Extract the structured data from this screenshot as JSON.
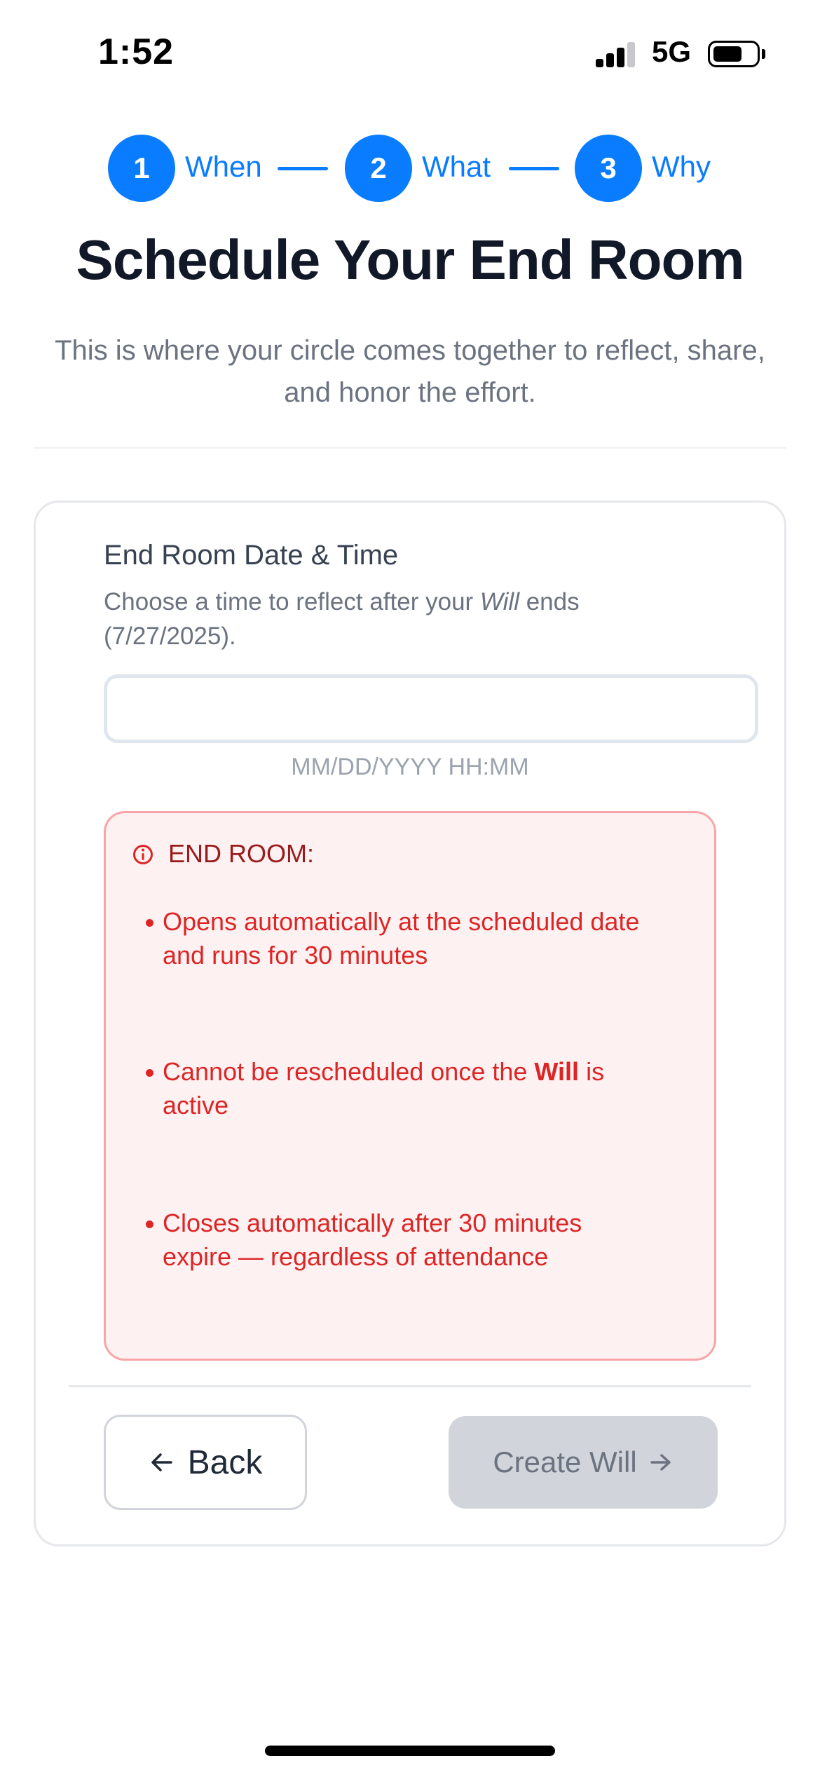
{
  "status_bar": {
    "time": "1:52",
    "network": "5G",
    "icons": [
      "cellular-signal-icon",
      "battery-icon"
    ]
  },
  "stepper": {
    "steps": [
      {
        "number": "1",
        "label": "When"
      },
      {
        "number": "2",
        "label": "What"
      },
      {
        "number": "3",
        "label": "Why"
      }
    ]
  },
  "header": {
    "title": "Schedule Your End Room",
    "subtitle": "This is where your circle comes together to reflect, share, and honor the effort."
  },
  "form": {
    "field_label": "End Room Date & Time",
    "help_prefix": "Choose a time to reflect after your ",
    "help_emphasis": "Will",
    "help_suffix": " ends (7/27/2025).",
    "date_value": "",
    "format_hint": "MM/DD/YYYY HH:MM"
  },
  "alert": {
    "icon": "info-circle-icon",
    "title": "END ROOM:",
    "bullets": [
      {
        "text": "Opens automatically at the scheduled date and runs for 30 minutes"
      },
      {
        "prefix": "Cannot be rescheduled once the ",
        "bold": "Will",
        "suffix": " is active"
      },
      {
        "text": "Closes automatically after 30 minutes expire — regardless of attendance"
      }
    ]
  },
  "actions": {
    "back_label": "Back",
    "create_label": "Create Will",
    "create_disabled": true
  },
  "colors": {
    "accent": "#0a7cff",
    "alert_text": "#dc2626",
    "alert_bg": "#fef1f2",
    "alert_border": "#f8a5a8",
    "disabled_button": "#d1d5db"
  }
}
